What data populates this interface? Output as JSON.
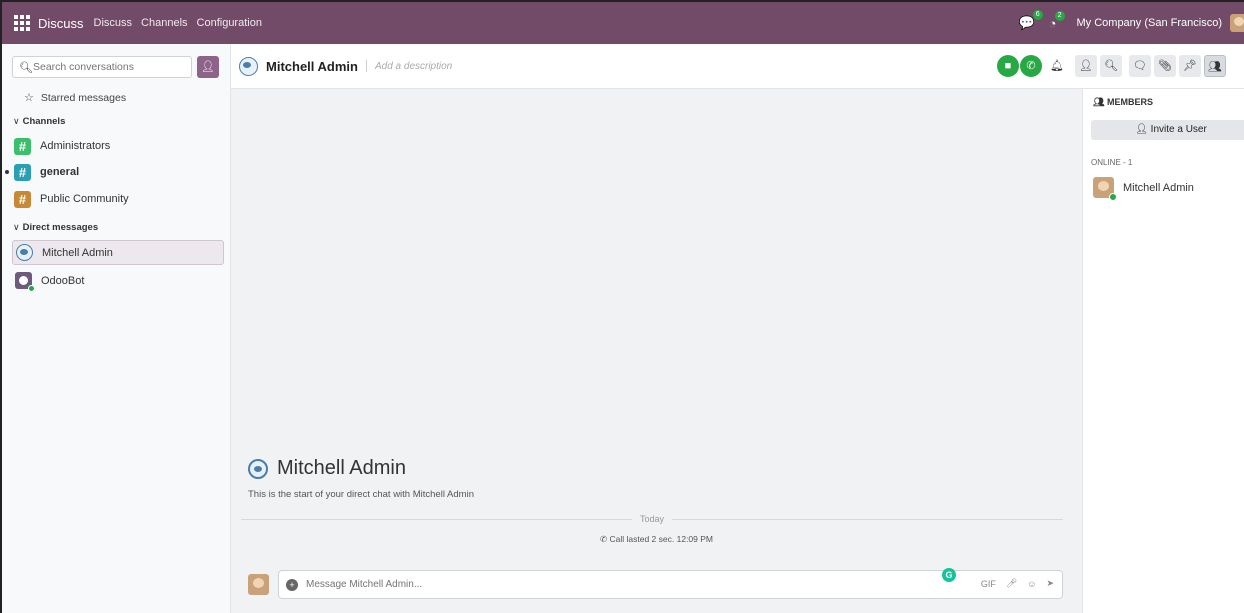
{
  "navbar": {
    "brand": "Discuss",
    "menu": [
      "Discuss",
      "Channels",
      "Configuration"
    ],
    "messages_badge": "6",
    "activity_badge": "2",
    "company": "My Company (San Francisco)"
  },
  "sidebar": {
    "search_placeholder": "Search conversations",
    "starred_label": "Starred messages",
    "channels_header": "Channels",
    "channels": [
      {
        "label": "Administrators"
      },
      {
        "label": "general"
      },
      {
        "label": "Public Community"
      }
    ],
    "dm_header": "Direct messages",
    "direct_messages": [
      {
        "label": "Mitchell Admin"
      },
      {
        "label": "OdooBot"
      }
    ]
  },
  "thread": {
    "name": "Mitchell Admin",
    "description_placeholder": "Add a description",
    "intro_name": "Mitchell Admin",
    "intro_text": "This is the start of your direct chat with Mitchell Admin",
    "day_separator": "Today",
    "call_note": "Call lasted 2 sec.",
    "call_time": "12:09 PM",
    "composer_placeholder": "Message Mitchell Admin...",
    "gif_label": "GIF"
  },
  "members": {
    "title": "MEMBERS",
    "invite_label": "Invite a User",
    "online_header": "ONLINE - 1",
    "list": [
      {
        "name": "Mitchell Admin"
      }
    ]
  },
  "colors": {
    "navbar": "#714b67",
    "call_green": "#28a745",
    "online": "#28a745"
  }
}
